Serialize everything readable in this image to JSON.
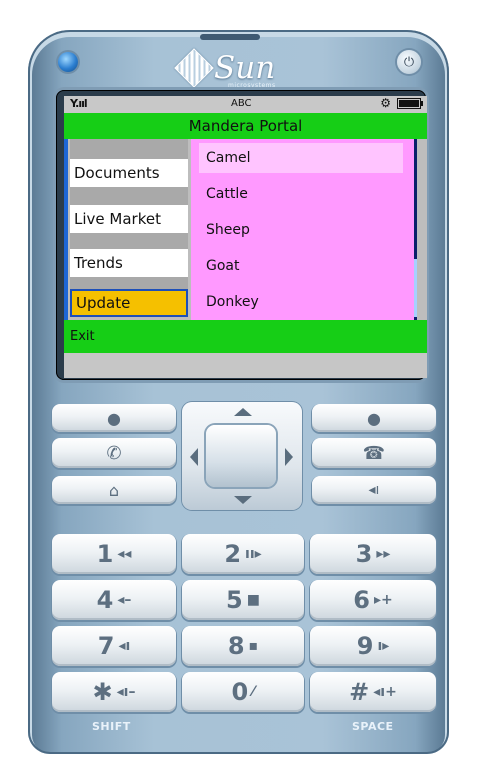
{
  "device": {
    "brand": "Sun",
    "brand_sub": "microsystems",
    "power_icon": "power-icon",
    "led_icon": "led-button"
  },
  "status": {
    "signal": "Y.ııl",
    "input_mode": "ABC",
    "icons": [
      "gear-icon",
      "battery-icon"
    ]
  },
  "screen": {
    "title": "Mandera Portal",
    "menu": [
      {
        "label": "Documents"
      },
      {
        "label": "Live Market"
      },
      {
        "label": "Trends"
      },
      {
        "label": "Update",
        "selected": true
      }
    ],
    "popup": {
      "items": [
        "Camel",
        "Cattle",
        "Sheep",
        "Goat",
        "Donkey"
      ],
      "highlighted": "Camel"
    },
    "softkey_left": "Exit"
  },
  "keypad": {
    "soft_left_icon": "dot-icon",
    "soft_right_icon": "dot-icon",
    "call_icon": "phone-call-icon",
    "end_icon": "end-call-icon",
    "home_icon": "home-icon",
    "clear_icon": "back-icon",
    "keys": [
      {
        "num": "1",
        "sym": "◂◂"
      },
      {
        "num": "2",
        "sym": "ıı▸"
      },
      {
        "num": "3",
        "sym": "▸▸"
      },
      {
        "num": "4",
        "sym": "◂–"
      },
      {
        "num": "5",
        "sym": "■"
      },
      {
        "num": "6",
        "sym": "▸+"
      },
      {
        "num": "7",
        "sym": "◂ı"
      },
      {
        "num": "8",
        "sym": "▪"
      },
      {
        "num": "9",
        "sym": "ı▸"
      },
      {
        "num": "✱",
        "sym": "◂ı–"
      },
      {
        "num": "0",
        "sym": "⁄"
      },
      {
        "num": "#",
        "sym": "◂ı+"
      }
    ],
    "shift_label": "SHIFT",
    "space_label": "SPACE"
  }
}
